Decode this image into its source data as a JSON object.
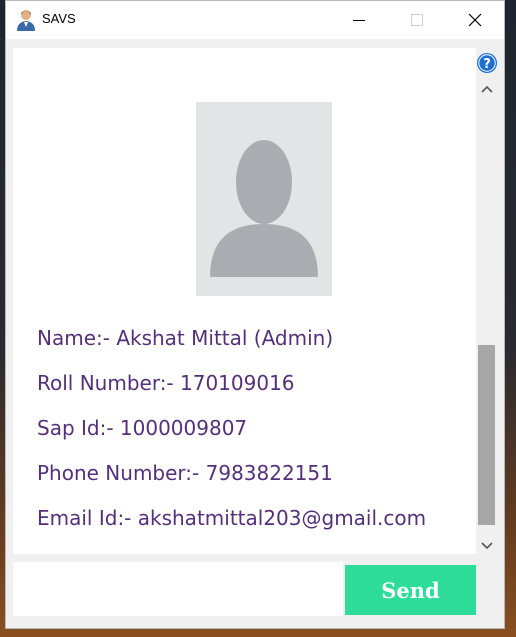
{
  "window": {
    "title": "SAVS",
    "app_icon": "user-avatar-icon",
    "controls": [
      "minimize-icon",
      "maximize-icon",
      "close-icon"
    ]
  },
  "profile": {
    "photo_icon": "default-user-silhouette-icon",
    "name": "Name:- Akshat Mittal (Admin)",
    "roll_number": "Roll Number:- 170109016",
    "sap_id": "Sap Id:- 1000009807",
    "phone": "Phone Number:- 7983822151",
    "email": "Email Id:- akshatmittal203@gmail.com"
  },
  "sidebar": {
    "help_icon": "help-icon",
    "scroll_up_icon": "chevron-up-icon",
    "scroll_down_icon": "chevron-down-icon"
  },
  "composer": {
    "input_value": "",
    "send_label": "Send"
  },
  "colors": {
    "info_text": "#54307a",
    "send_button": "#2edc9a",
    "help_icon": "#1f6fd1"
  }
}
